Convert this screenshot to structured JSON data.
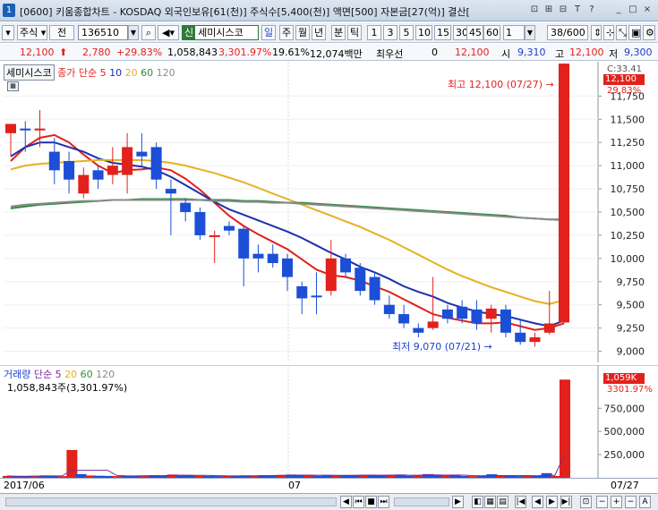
{
  "window": {
    "number": "1",
    "title": "[0600] 키움종합차트 - KOSDAQ 외국인보유[61(천)] 주식수[5,400(천)] 액면[500] 자본금[27(억)] 결산[",
    "buttons": [
      "⊡",
      "⊞",
      "⊟",
      "T",
      "?",
      "_",
      "□",
      "×"
    ]
  },
  "toolbar": {
    "market": "주식",
    "prev_label": "전",
    "code": "136510",
    "stock_name_badge": "신",
    "stock_name": "세미시스코",
    "periods": [
      "일",
      "주",
      "월",
      "년",
      "분",
      "틱"
    ],
    "intervals": [
      "1",
      "3",
      "5",
      "10",
      "15",
      "30",
      "45",
      "60"
    ],
    "interval_select": "1",
    "page_info": "38/600"
  },
  "quote": {
    "price": "12,100",
    "change": "2,780",
    "change_pct": "+29.83%",
    "volume": "1,058,843",
    "volume_pct": "3,301.97%",
    "turnover": "19.61%",
    "amount": "12,074백만",
    "best_ask_label": "최우선",
    "best_ask_qty": "0",
    "best_price": "12,100",
    "open_label": "시",
    "open": "9,310",
    "high_label": "고",
    "high": "12,100",
    "low_label": "저",
    "low": "9,300"
  },
  "price_panel": {
    "legend_name": "세미시스코",
    "legend_type": "종가 단순",
    "ma": [
      {
        "period": "5",
        "color": "#e2211c"
      },
      {
        "period": "10",
        "color": "#1c2fb0"
      },
      {
        "period": "20",
        "color": "#e6b120"
      },
      {
        "period": "60",
        "color": "#2e8b3c"
      },
      {
        "period": "120",
        "color": "#8a8a8a"
      }
    ],
    "current_label": "12,100",
    "c_label": "C:33.41",
    "pct_label": "29.83%",
    "high_annotation": "최고 12,100 (07/27)",
    "low_annotation": "최저 9,070 (07/21)"
  },
  "volume_panel": {
    "legend_name": "거래량",
    "legend_type": "단순",
    "ma_periods": [
      "5",
      "20",
      "60",
      "120"
    ],
    "ma_colors": [
      "#7d2a9b",
      "#e6b120",
      "#2e8b3c",
      "#8a8a8a"
    ],
    "value_label": "1,058,843주(3,301.97%)",
    "current_label": "1,059K",
    "pct_label": "3301.97%"
  },
  "date_axis": {
    "labels": [
      "2017/06",
      "07",
      "07/27"
    ]
  },
  "chart_data": [
    {
      "type": "candlestick",
      "title": "세미시스코",
      "y_ticks": [
        9000,
        9250,
        9500,
        9750,
        10000,
        10250,
        10500,
        10750,
        11000,
        11250,
        11500,
        11750
      ],
      "ylim": [
        8880,
        12120
      ],
      "candles": [
        {
          "o": 11350,
          "h": 11450,
          "l": 11100,
          "c": 11450,
          "up": true
        },
        {
          "o": 11400,
          "h": 11480,
          "l": 11150,
          "c": 11380,
          "up": false
        },
        {
          "o": 11380,
          "h": 11600,
          "l": 11200,
          "c": 11400,
          "up": true
        },
        {
          "o": 11150,
          "h": 11300,
          "l": 10800,
          "c": 10950,
          "up": false
        },
        {
          "o": 11050,
          "h": 11150,
          "l": 10700,
          "c": 10850,
          "up": false
        },
        {
          "o": 10700,
          "h": 10980,
          "l": 10650,
          "c": 10900,
          "up": true
        },
        {
          "o": 10950,
          "h": 11000,
          "l": 10750,
          "c": 10850,
          "up": false
        },
        {
          "o": 10900,
          "h": 11200,
          "l": 10800,
          "c": 11000,
          "up": true
        },
        {
          "o": 10900,
          "h": 11350,
          "l": 10700,
          "c": 11200,
          "up": true
        },
        {
          "o": 11150,
          "h": 11350,
          "l": 11000,
          "c": 11100,
          "up": false
        },
        {
          "o": 11200,
          "h": 11250,
          "l": 10750,
          "c": 10850,
          "up": false
        },
        {
          "o": 10750,
          "h": 10850,
          "l": 10250,
          "c": 10700,
          "up": false
        },
        {
          "o": 10600,
          "h": 10650,
          "l": 10400,
          "c": 10500,
          "up": false
        },
        {
          "o": 10500,
          "h": 10550,
          "l": 10200,
          "c": 10250,
          "up": false
        },
        {
          "o": 10250,
          "h": 10300,
          "l": 9950,
          "c": 10250,
          "up": true
        },
        {
          "o": 10350,
          "h": 10400,
          "l": 10250,
          "c": 10300,
          "up": false
        },
        {
          "o": 10320,
          "h": 10350,
          "l": 9700,
          "c": 10000,
          "up": false
        },
        {
          "o": 10050,
          "h": 10150,
          "l": 9850,
          "c": 10000,
          "up": false
        },
        {
          "o": 10050,
          "h": 10150,
          "l": 9900,
          "c": 9950,
          "up": false
        },
        {
          "o": 10000,
          "h": 10050,
          "l": 9650,
          "c": 9800,
          "up": false
        },
        {
          "o": 9700,
          "h": 9750,
          "l": 9400,
          "c": 9570,
          "up": false
        },
        {
          "o": 9600,
          "h": 9850,
          "l": 9400,
          "c": 9600,
          "up": false
        },
        {
          "o": 9650,
          "h": 10200,
          "l": 9600,
          "c": 10000,
          "up": true
        },
        {
          "o": 10000,
          "h": 10050,
          "l": 9800,
          "c": 9850,
          "up": false
        },
        {
          "o": 9900,
          "h": 9950,
          "l": 9600,
          "c": 9650,
          "up": false
        },
        {
          "o": 9800,
          "h": 9850,
          "l": 9500,
          "c": 9550,
          "up": false
        },
        {
          "o": 9500,
          "h": 9600,
          "l": 9350,
          "c": 9400,
          "up": false
        },
        {
          "o": 9400,
          "h": 9500,
          "l": 9250,
          "c": 9300,
          "up": false
        },
        {
          "o": 9250,
          "h": 9300,
          "l": 9150,
          "c": 9200,
          "up": false
        },
        {
          "o": 9250,
          "h": 9800,
          "l": 9230,
          "c": 9320,
          "up": true
        },
        {
          "o": 9450,
          "h": 9500,
          "l": 9300,
          "c": 9350,
          "up": false
        },
        {
          "o": 9480,
          "h": 9550,
          "l": 9300,
          "c": 9350,
          "up": false
        },
        {
          "o": 9450,
          "h": 9550,
          "l": 9230,
          "c": 9300,
          "up": false
        },
        {
          "o": 9350,
          "h": 9500,
          "l": 9200,
          "c": 9460,
          "up": true
        },
        {
          "o": 9450,
          "h": 9500,
          "l": 9150,
          "c": 9200,
          "up": false
        },
        {
          "o": 9200,
          "h": 9350,
          "l": 9070,
          "c": 9100,
          "up": false
        },
        {
          "o": 9100,
          "h": 9200,
          "l": 9050,
          "c": 9150,
          "up": true
        },
        {
          "o": 9200,
          "h": 9650,
          "l": 9180,
          "c": 9300,
          "up": true
        },
        {
          "o": 9310,
          "h": 12100,
          "l": 9300,
          "c": 12100,
          "up": true
        }
      ],
      "ma_series": [
        {
          "name": "5",
          "color": "#e2211c",
          "values": [
            11050,
            11200,
            11300,
            11330,
            11250,
            11120,
            11000,
            10920,
            10950,
            10960,
            10980,
            10950,
            10860,
            10740,
            10600,
            10460,
            10350,
            10260,
            10180,
            10100,
            9990,
            9880,
            9820,
            9800,
            9760,
            9700,
            9640,
            9560,
            9480,
            9400,
            9360,
            9330,
            9300,
            9300,
            9310,
            9270,
            9230,
            9250,
            9300
          ]
        },
        {
          "name": "10",
          "color": "#1c2fb0",
          "values": [
            11100,
            11200,
            11250,
            11250,
            11200,
            11150,
            11080,
            11030,
            11010,
            10990,
            10950,
            10880,
            10790,
            10700,
            10610,
            10530,
            10470,
            10410,
            10350,
            10290,
            10220,
            10140,
            10060,
            9990,
            9910,
            9850,
            9780,
            9700,
            9640,
            9590,
            9520,
            9470,
            9430,
            9400,
            9380,
            9340,
            9300,
            9270,
            9330
          ]
        },
        {
          "name": "20",
          "color": "#e6b120",
          "values": [
            10960,
            11000,
            11020,
            11030,
            11040,
            11050,
            11060,
            11060,
            11060,
            11060,
            11050,
            11030,
            11000,
            10960,
            10920,
            10870,
            10820,
            10760,
            10700,
            10640,
            10580,
            10520,
            10460,
            10400,
            10340,
            10270,
            10200,
            10120,
            10040,
            9960,
            9880,
            9810,
            9750,
            9690,
            9640,
            9590,
            9540,
            9510,
            9550
          ]
        },
        {
          "name": "60",
          "color": "#2e8b3c",
          "values": [
            10540,
            10560,
            10580,
            10590,
            10600,
            10610,
            10620,
            10630,
            10630,
            10640,
            10640,
            10640,
            10640,
            10630,
            10630,
            10630,
            10620,
            10620,
            10610,
            10600,
            10600,
            10590,
            10580,
            10570,
            10560,
            10550,
            10540,
            10530,
            10520,
            10510,
            10500,
            10490,
            10480,
            10470,
            10460,
            10440,
            10430,
            10420,
            10420
          ]
        },
        {
          "name": "120",
          "color": "#8a8a8a",
          "values": [
            10560,
            10580,
            10590,
            10600,
            10610,
            10620,
            10620,
            10630,
            10630,
            10630,
            10630,
            10630,
            10630,
            10630,
            10620,
            10620,
            10610,
            10610,
            10600,
            10600,
            10590,
            10580,
            10570,
            10560,
            10550,
            10540,
            10530,
            10520,
            10510,
            10500,
            10490,
            10480,
            10470,
            10460,
            10450,
            10440,
            10430,
            10420,
            10410
          ]
        }
      ]
    },
    {
      "type": "bar",
      "title": "거래량",
      "y_ticks": [
        250000,
        500000,
        750000
      ],
      "ylim": [
        0,
        1100000
      ],
      "values": [
        20000,
        15000,
        18000,
        22000,
        25000,
        20000,
        18000,
        300000,
        40000,
        25000,
        22000,
        20000,
        18000,
        22000,
        20000,
        25000,
        28000,
        22000,
        35000,
        30000,
        25000,
        22000,
        20000,
        18000,
        22000,
        20000,
        25000,
        22000,
        28000,
        25000,
        30000,
        35000,
        25000,
        28000,
        22000,
        30000,
        28000,
        25000,
        30000,
        32000,
        28000,
        25000,
        30000,
        35000,
        22000,
        28000,
        40000,
        30000,
        25000,
        28000,
        20000,
        18000,
        22000,
        38000,
        25000,
        20000,
        18000,
        22000,
        25000,
        50000,
        20000,
        1058843
      ]
    }
  ]
}
